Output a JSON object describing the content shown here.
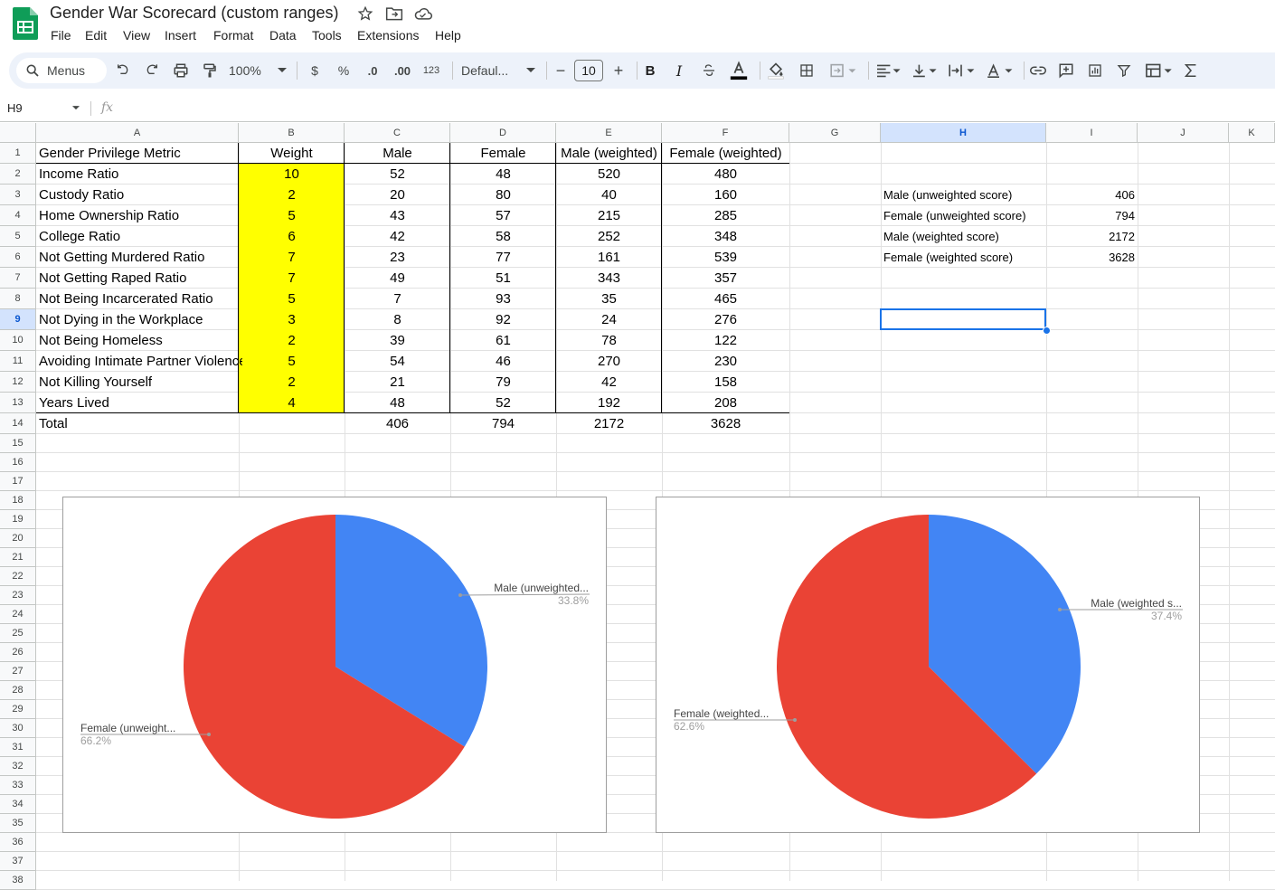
{
  "app": {
    "title": "Gender War Scorecard (custom ranges)",
    "menu": [
      "File",
      "Edit",
      "View",
      "Insert",
      "Format",
      "Data",
      "Tools",
      "Extensions",
      "Help"
    ]
  },
  "toolbar": {
    "search_label": "Menus",
    "zoom": "100%",
    "currency": "$",
    "percent": "%",
    "dec_decrease": ".0",
    "dec_increase": ".00",
    "number_format": "123",
    "font": "Defaul...",
    "font_size": "10",
    "minus": "−",
    "plus": "+",
    "bold": "B",
    "italic": "I"
  },
  "formula_bar": {
    "cell_ref": "H9",
    "fx": "fx",
    "content": ""
  },
  "columns": [
    "A",
    "B",
    "C",
    "D",
    "E",
    "F",
    "G",
    "H",
    "I",
    "J",
    "K"
  ],
  "selected": {
    "column": "H",
    "row": "9"
  },
  "rows": [
    "1",
    "2",
    "3",
    "4",
    "5",
    "6",
    "7",
    "8",
    "9",
    "10",
    "11",
    "12",
    "13",
    "14",
    "15",
    "16",
    "17",
    "18",
    "19",
    "20",
    "21",
    "22",
    "23",
    "24",
    "25",
    "26",
    "27",
    "28",
    "29",
    "30",
    "31",
    "32",
    "33",
    "34",
    "35",
    "36",
    "37",
    "38"
  ],
  "table": {
    "headers": [
      "Gender Privilege Metric",
      "Weight",
      "Male",
      "Female",
      "Male (weighted)",
      "Female (weighted)"
    ],
    "rows": [
      [
        "Income Ratio",
        "10",
        "52",
        "48",
        "520",
        "480"
      ],
      [
        "Custody Ratio",
        "2",
        "20",
        "80",
        "40",
        "160"
      ],
      [
        "Home Ownership Ratio",
        "5",
        "43",
        "57",
        "215",
        "285"
      ],
      [
        "College Ratio",
        "6",
        "42",
        "58",
        "252",
        "348"
      ],
      [
        "Not Getting Murdered Ratio",
        "7",
        "23",
        "77",
        "161",
        "539"
      ],
      [
        "Not Getting Raped Ratio",
        "7",
        "49",
        "51",
        "343",
        "357"
      ],
      [
        "Not Being Incarcerated Ratio",
        "5",
        "7",
        "93",
        "35",
        "465"
      ],
      [
        "Not Dying in the Workplace",
        "3",
        "8",
        "92",
        "24",
        "276"
      ],
      [
        "Not Being Homeless",
        "2",
        "39",
        "61",
        "78",
        "122"
      ],
      [
        "Avoiding Intimate Partner Violence",
        "5",
        "54",
        "46",
        "270",
        "230"
      ],
      [
        "Not Killing Yourself",
        "2",
        "21",
        "79",
        "42",
        "158"
      ],
      [
        "Years Lived",
        "4",
        "48",
        "52",
        "192",
        "208"
      ]
    ],
    "total": [
      "Total",
      "",
      "406",
      "794",
      "2172",
      "3628"
    ]
  },
  "summary": [
    {
      "label": "Male (unweighted score)",
      "value": "406"
    },
    {
      "label": "Female (unweighted score)",
      "value": "794"
    },
    {
      "label": "Male (weighted score)",
      "value": "2172"
    },
    {
      "label": "Female (weighted score)",
      "value": "3628"
    }
  ],
  "colors": {
    "male": "#4285f4",
    "female": "#ea4335",
    "weight_fill": "#ffff00",
    "selection": "#1a73e8"
  },
  "chart_data": [
    {
      "type": "pie",
      "title": "",
      "slices": [
        {
          "label": "Male (unweighted...",
          "value": 406,
          "percent": "33.8%",
          "color": "#4285f4"
        },
        {
          "label": "Female (unweight...",
          "value": 794,
          "percent": "66.2%",
          "color": "#ea4335"
        }
      ]
    },
    {
      "type": "pie",
      "title": "",
      "slices": [
        {
          "label": "Male (weighted s...",
          "value": 2172,
          "percent": "37.4%",
          "color": "#4285f4"
        },
        {
          "label": "Female (weighted...",
          "value": 3628,
          "percent": "62.6%",
          "color": "#ea4335"
        }
      ]
    }
  ]
}
